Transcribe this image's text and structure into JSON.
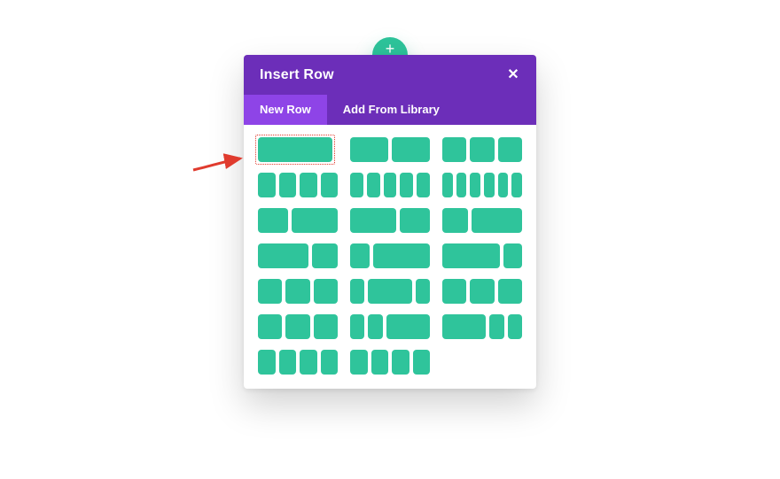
{
  "colors": {
    "primary": "#6c2eb9",
    "primaryLight": "#8e44e7",
    "accent": "#2fc49b",
    "highlight": "#e03b2e"
  },
  "header": {
    "title": "Insert Row"
  },
  "tabs": {
    "new_row": "New Row",
    "add_from_library": "Add From Library"
  },
  "addCircle": {
    "glyph": "+"
  },
  "layouts": [
    {
      "id": "1-col",
      "cols": [
        "f1"
      ]
    },
    {
      "id": "2-col-half",
      "cols": [
        "f12",
        "f12"
      ]
    },
    {
      "id": "3-col-third",
      "cols": [
        "f13",
        "f13",
        "f13"
      ]
    },
    {
      "id": "4-col-quarter",
      "cols": [
        "f14",
        "f14",
        "f14",
        "f14"
      ]
    },
    {
      "id": "5-col-fifth",
      "cols": [
        "f15",
        "f15",
        "f15",
        "f15",
        "f15"
      ]
    },
    {
      "id": "6-col-sixth",
      "cols": [
        "f16",
        "f16",
        "f16",
        "f16",
        "f16",
        "f16"
      ]
    },
    {
      "id": "2-5-3-5",
      "cols": [
        "f25",
        "f35"
      ]
    },
    {
      "id": "3-5-2-5",
      "cols": [
        "f35",
        "f25"
      ]
    },
    {
      "id": "1-3-2-3",
      "cols": [
        "f13",
        "f23"
      ]
    },
    {
      "id": "2-3-1-3",
      "cols": [
        "f23",
        "f13"
      ]
    },
    {
      "id": "1-4-3-4",
      "cols": [
        "f14",
        "f34"
      ]
    },
    {
      "id": "3-4-1-4",
      "cols": [
        "f34",
        "f14"
      ]
    },
    {
      "id": "1-4-1-2-1-4",
      "cols": [
        "f14",
        "f12",
        "f14"
      ]
    },
    {
      "id": "1-5-3-5-1-5",
      "cols": [
        "f15",
        "f35",
        "f15"
      ]
    },
    {
      "id": "1-4-1-4-1-2",
      "cols": [
        "f14",
        "f14",
        "f12"
      ]
    },
    {
      "id": "1-2-1-4-1-4",
      "cols": [
        "f12",
        "f14",
        "f14"
      ]
    },
    {
      "id": "1-5-1-5-3-5",
      "cols": [
        "f15",
        "f15",
        "f35"
      ]
    },
    {
      "id": "3-5-1-5-1-5",
      "cols": [
        "f35",
        "f15",
        "f15"
      ]
    },
    {
      "id": "1-6-1-6-1-6-1-2",
      "cols": [
        "f16",
        "f16",
        "f16",
        "f12"
      ]
    },
    {
      "id": "1-2-1-6-1-6-1-6",
      "cols": [
        "f12",
        "f16",
        "f16",
        "f16"
      ]
    }
  ]
}
